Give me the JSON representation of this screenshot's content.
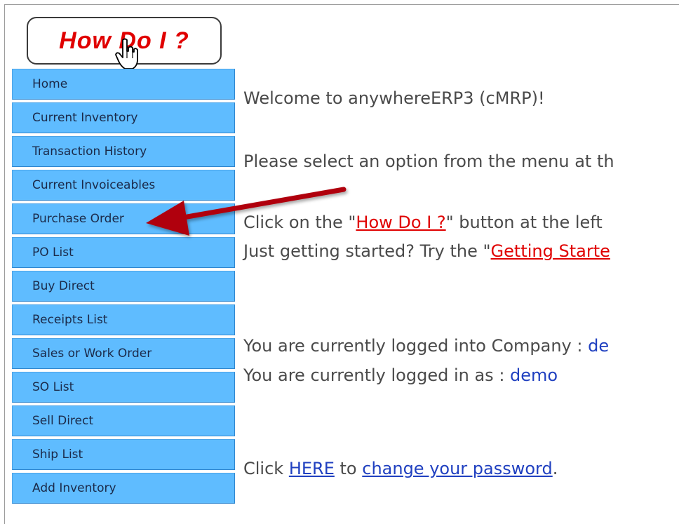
{
  "how_do_i_button": {
    "label": "How Do I ?"
  },
  "menu": {
    "items": [
      "Home",
      "Current Inventory",
      "Transaction History",
      "Current Invoiceables",
      "Purchase Order",
      "PO List",
      "Buy Direct",
      "Receipts List",
      "Sales or Work Order",
      "SO List",
      "Sell Direct",
      "Ship List",
      "Add Inventory"
    ]
  },
  "content": {
    "welcome": "Welcome to anywhereERP3 (cMRP)!",
    "select_prompt": "Please select an option from the menu at th",
    "click_prefix": "Click on the \"",
    "how_do_i_link": "How Do I ?",
    "click_suffix": "\" button at the left",
    "started_prefix": "Just getting started? Try the \"",
    "getting_started_link": "Getting Starte",
    "company_prefix": "You are currently logged into Company : ",
    "company_value": "de",
    "user_prefix": "You are currently logged in as : ",
    "user_value": "demo",
    "pw_click": "Click ",
    "here_link": "HERE",
    "pw_to": " to ",
    "change_password_link": "change your password",
    "pw_end": "."
  },
  "colors": {
    "menu_bg": "#5fbcff",
    "link_red": "#e00000",
    "link_blue": "#2040c0",
    "arrow": "#b00010"
  },
  "icons": [
    "hand-pointer-icon",
    "annotation-arrow"
  ]
}
